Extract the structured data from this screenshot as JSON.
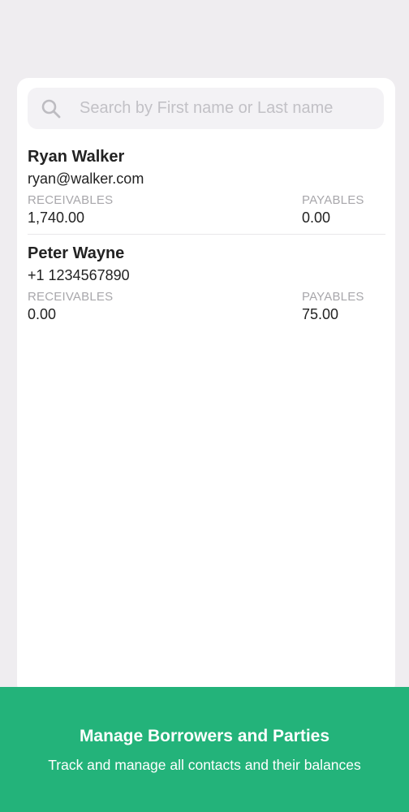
{
  "search": {
    "placeholder": "Search by First name or Last name",
    "icon": "search-icon"
  },
  "contacts": [
    {
      "name": "Ryan Walker",
      "detail": "ryan@walker.com",
      "receivables_label": "RECEIVABLES",
      "receivables": "1,740.00",
      "payables_label": "PAYABLES",
      "payables": "0.00"
    },
    {
      "name": "Peter Wayne",
      "detail": "+1 1234567890",
      "receivables_label": "RECEIVABLES",
      "receivables": "0.00",
      "payables_label": "PAYABLES",
      "payables": "75.00"
    }
  ],
  "banner": {
    "title": "Manage Borrowers and Parties",
    "subtitle": "Track and manage all contacts and their balances",
    "color": "#23b37a"
  },
  "colors": {
    "background": "#efedf0",
    "card": "#ffffff",
    "label": "#a8a7ab"
  }
}
